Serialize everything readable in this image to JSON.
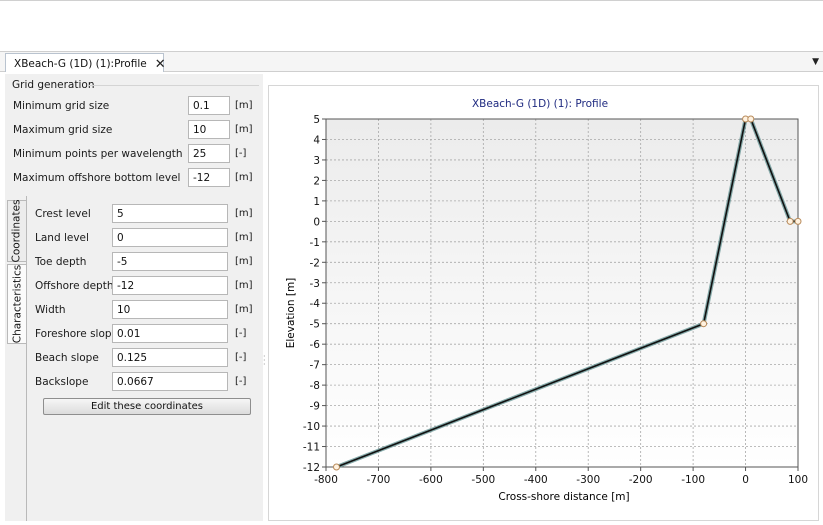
{
  "tab": {
    "title": "XBeach-G (1D) (1):Profile",
    "close_glyph": "✕",
    "menu_glyph": "▼"
  },
  "grid_generation": {
    "title": "Grid generation",
    "fields": [
      {
        "label": "Minimum grid size",
        "value": "0.1",
        "unit": "[m]"
      },
      {
        "label": "Maximum grid size",
        "value": "10",
        "unit": "[m]"
      },
      {
        "label": "Minimum points per wavelength",
        "value": "25",
        "unit": "[-]"
      },
      {
        "label": "Maximum offshore bottom level",
        "value": "-12",
        "unit": "[m]"
      }
    ]
  },
  "side_tabs": {
    "coordinates": "Coordinates",
    "characteristics": "Characteristics",
    "active": "characteristics"
  },
  "characteristics": {
    "fields": [
      {
        "label": "Crest level",
        "value": "5",
        "unit": "[m]"
      },
      {
        "label": "Land level",
        "value": "0",
        "unit": "[m]"
      },
      {
        "label": "Toe depth",
        "value": "-5",
        "unit": "[m]"
      },
      {
        "label": "Offshore depth",
        "value": "-12",
        "unit": "[m]"
      },
      {
        "label": "Width",
        "value": "10",
        "unit": "[m]"
      },
      {
        "label": "Foreshore slope",
        "value": "0.01",
        "unit": "[-]"
      },
      {
        "label": "Beach slope",
        "value": "0.125",
        "unit": "[-]"
      },
      {
        "label": "Backslope",
        "value": "0.0667",
        "unit": "[-]"
      }
    ],
    "edit_button_label": "Edit these coordinates"
  },
  "chart_data": {
    "type": "line",
    "title": "XBeach-G (1D) (1): Profile",
    "xlabel": "Cross-shore distance [m]",
    "ylabel": "Elevation [m]",
    "xlim": [
      -800,
      100
    ],
    "ylim": [
      -12,
      5
    ],
    "xticks": [
      -800,
      -700,
      -600,
      -500,
      -400,
      -300,
      -200,
      -100,
      0,
      100
    ],
    "yticks": [
      5,
      4,
      3,
      2,
      1,
      0,
      -1,
      -2,
      -3,
      -4,
      -5,
      -6,
      -7,
      -8,
      -9,
      -10,
      -11,
      -12
    ],
    "grid": true,
    "series": [
      {
        "values": [
          [
            -780,
            -12
          ],
          [
            -80,
            -5
          ],
          [
            0,
            5
          ],
          [
            10,
            5
          ],
          [
            85,
            0
          ],
          [
            100,
            0
          ]
        ]
      }
    ],
    "markers": [
      [
        -780,
        -12
      ],
      [
        -80,
        -5
      ],
      [
        0,
        5
      ],
      [
        10,
        5
      ],
      [
        85,
        0
      ],
      [
        100,
        0
      ]
    ],
    "colors": {
      "line": "#111111",
      "line_halo": "#5f8f8f",
      "marker_fill": "#fff2e0",
      "marker_stroke": "#b88a5a",
      "title": "#1f2a80",
      "plot_bg": "#ececec"
    }
  }
}
